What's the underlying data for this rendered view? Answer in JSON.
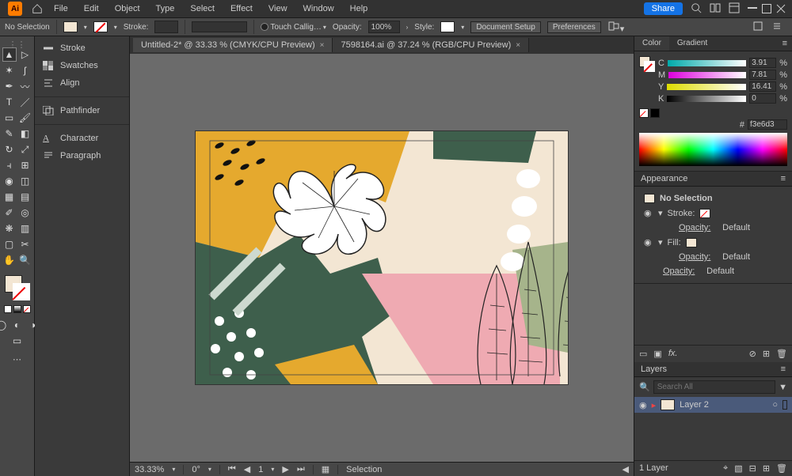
{
  "menubar": {
    "items": [
      "File",
      "Edit",
      "Object",
      "Type",
      "Select",
      "Effect",
      "View",
      "Window",
      "Help"
    ],
    "share": "Share"
  },
  "optbar": {
    "noselection": "No Selection",
    "stroke_label": "Stroke:",
    "touch": "Touch Callig…",
    "opacity_label": "Opacity:",
    "opacity_value": "100%",
    "style_label": "Style:",
    "docsetup": "Document Setup",
    "prefs": "Preferences"
  },
  "leftPanels": [
    {
      "label": "Stroke"
    },
    {
      "label": "Swatches"
    },
    {
      "label": "Align"
    },
    {
      "label": "Pathfinder"
    },
    {
      "label": "Character"
    },
    {
      "label": "Paragraph"
    }
  ],
  "tabs": [
    {
      "label": "Untitled-2* @ 33.33 % (CMYK/CPU Preview)",
      "active": true
    },
    {
      "label": "7598164.ai @ 37.24 % (RGB/CPU Preview)",
      "active": false
    }
  ],
  "status": {
    "zoom": "33.33%",
    "rotate": "0°",
    "artboard": "1",
    "mode": "Selection"
  },
  "color": {
    "tab_color": "Color",
    "tab_gradient": "Gradient",
    "c": {
      "v": "3.91",
      "u": "%"
    },
    "m": {
      "v": "7.81",
      "u": "%"
    },
    "y": {
      "v": "16.41",
      "u": "%"
    },
    "k": {
      "v": "0",
      "u": "%"
    },
    "hex": "f3e6d3"
  },
  "appearance": {
    "title": "Appearance",
    "nosel": "No Selection",
    "stroke": "Stroke:",
    "fill": "Fill:",
    "op": "Opacity:",
    "def": "Default"
  },
  "layers": {
    "title": "Layers",
    "search_ph": "Search All",
    "name": "Layer 2",
    "count": "1 Layer"
  }
}
